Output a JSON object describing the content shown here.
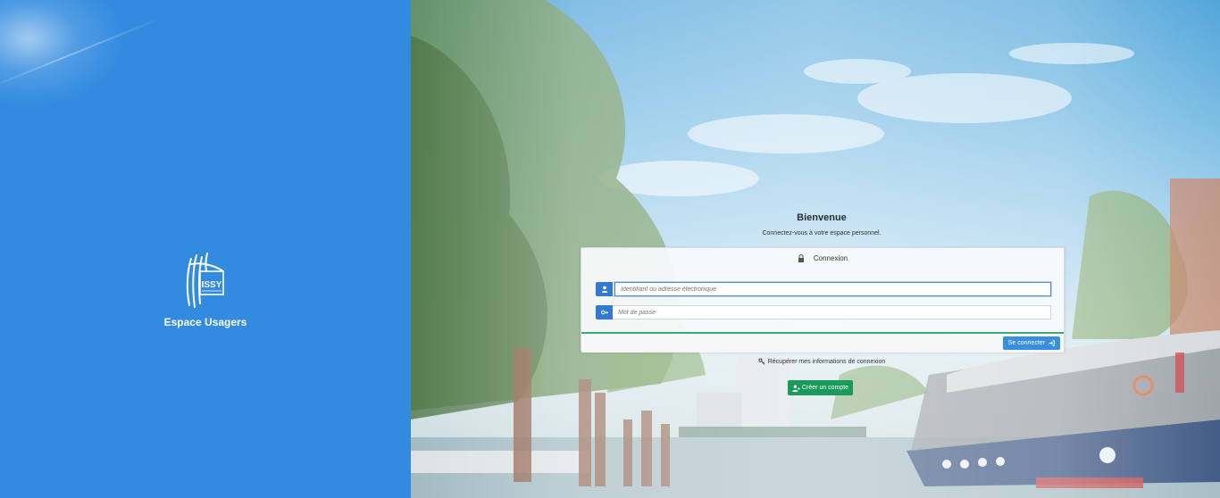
{
  "brand": {
    "name": "Espace Usagers",
    "logo_text": "ISSY",
    "panel_color": "#338be0"
  },
  "welcome": {
    "title": "Bienvenue",
    "subtitle": "Connectez-vous à votre espace personnel."
  },
  "login": {
    "header": "Connexion",
    "identifier_placeholder": "Identifiant ou adresse électronique",
    "password_placeholder": "Mot de passe",
    "submit_label": "Se connecter",
    "accent": "#3379d0"
  },
  "links": {
    "recover_label": "Récupérer mes informations de connexion"
  },
  "create_account": {
    "label": "Créer un compte",
    "color": "#1a9a5c"
  }
}
